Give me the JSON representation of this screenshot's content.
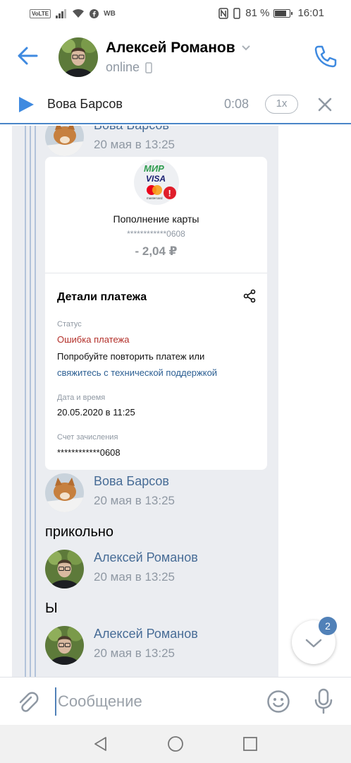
{
  "status_bar": {
    "volte": "VoLTE",
    "carrier_badge": "WB",
    "battery": "81 %",
    "battery_level": 0.81,
    "time": "16:01"
  },
  "header": {
    "name": "Алексей Романов",
    "status": "online"
  },
  "player": {
    "track": "Вова Барсов",
    "time": "0:08",
    "speed": "1x"
  },
  "messages": [
    {
      "author": "Вова Барсов",
      "date": "20 мая в 13:25"
    },
    {
      "author": "Вова Барсов",
      "date": "20 мая в 13:25",
      "text": "прикольно"
    },
    {
      "author": "Алексей Романов",
      "date": "20 мая в 13:25",
      "text": "Ы"
    },
    {
      "author": "Алексей Романов",
      "date": "20 мая в 13:25"
    }
  ],
  "payment": {
    "title": "Пополнение карты",
    "masked_card": "************0608",
    "amount": "- 2,04 ₽",
    "details_title": "Детали платежа",
    "status_label": "Статус",
    "status_value": "Ошибка платежа",
    "hint": "Попробуйте повторить платеж или",
    "support_link": "свяжитесь с технической поддержкой",
    "date_label": "Дата и время",
    "date_value": "20.05.2020 в 11:25",
    "account_label": "Счет зачисления",
    "account_value": "************0608",
    "logo_mir": "МИР",
    "logo_visa": "VISA",
    "logo_mc": "mastercard",
    "logo_alert": "!"
  },
  "unread_count": "2",
  "composer": {
    "placeholder": "Сообщение"
  },
  "colors": {
    "accent": "#5181b8",
    "link": "#2c5f93",
    "error": "#b3302a",
    "forward_panel": "#ebedf1"
  }
}
